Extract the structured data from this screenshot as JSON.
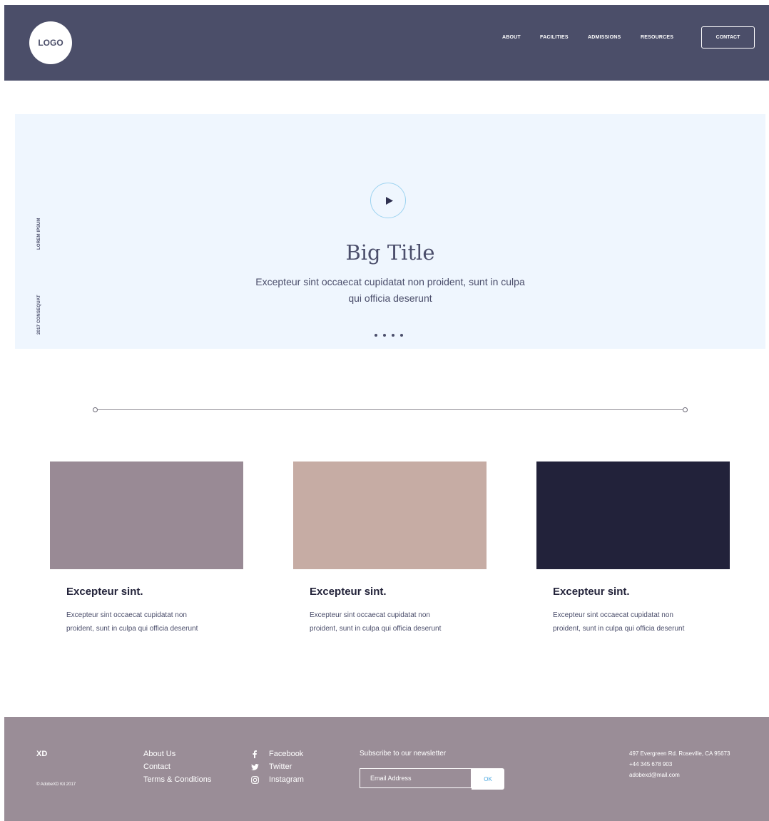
{
  "header": {
    "logo": "LOGO",
    "nav": [
      "ABOUT",
      "FACILITIES",
      "ADMISSIONS",
      "RESOURCES"
    ],
    "contact_button": "CONTACT"
  },
  "hero": {
    "side_label_top": "LOREM IPSUM",
    "side_label_bottom": "2017 CONSEQUAT",
    "title": "Big Title",
    "subtitle": "Excepteur sint occaecat cupidatat non proident, sunt in culpa qui officia deserunt",
    "slide_count": 4
  },
  "cards": [
    {
      "title": "Excepteur sint.",
      "text": "Excepteur sint occaecat cupidatat non proident, sunt in culpa qui officia deserunt",
      "color": "#998a95"
    },
    {
      "title": "Excepteur sint.",
      "text": "Excepteur sint occaecat cupidatat non proident, sunt in culpa qui officia deserunt",
      "color": "#c6aca4"
    },
    {
      "title": "Excepteur sint.",
      "text": "Excepteur sint occaecat cupidatat non proident, sunt in culpa qui officia deserunt",
      "color": "#22223a"
    }
  ],
  "footer": {
    "brand": "XD",
    "copyright": "© AdobeXD Kit 2017",
    "links": [
      "About Us",
      "Contact",
      "Terms & Conditions"
    ],
    "social": [
      {
        "icon": "facebook-icon",
        "label": "Facebook"
      },
      {
        "icon": "twitter-icon",
        "label": "Twitter"
      },
      {
        "icon": "instagram-icon",
        "label": "Instagram"
      }
    ],
    "newsletter_label": "Subscribe to our newsletter",
    "email_placeholder": "Email Address",
    "ok_button": "OK",
    "address": "497 Evergreen Rd. Roseville, CA 95673",
    "phone": "+44 345 678 903",
    "email": "adobexd@mail.com"
  },
  "colors": {
    "header_bg": "#4b4e69",
    "hero_bg": "#eff6fe",
    "footer_bg": "#9a8d97",
    "accent": "#4aa8e0"
  }
}
